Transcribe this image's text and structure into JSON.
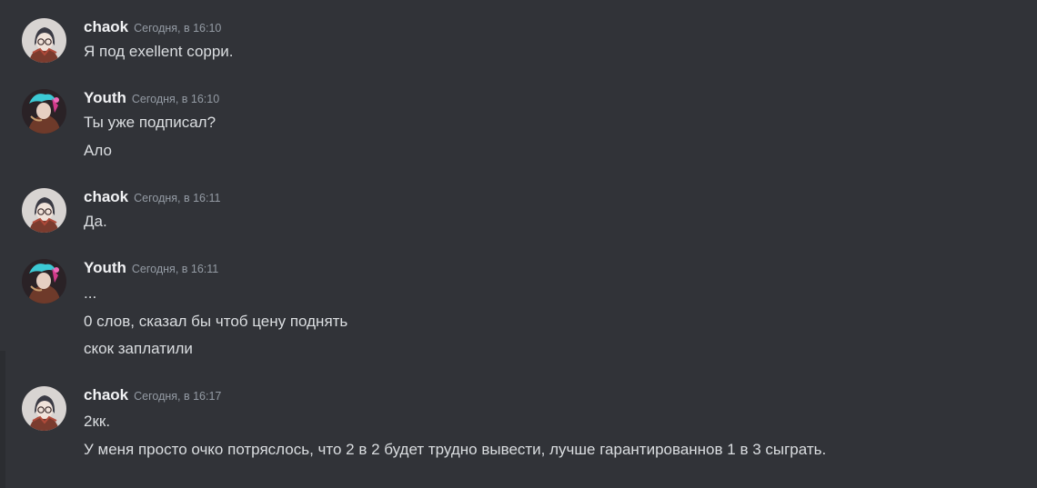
{
  "colors": {
    "background": "#313338",
    "username": "#f2f3f5",
    "timestamp": "#949ba4",
    "message_text": "#dbdee1"
  },
  "messages": [
    {
      "author": "chaok",
      "avatar_icon": "chaok-avatar-icon",
      "timestamp": "Сегодня, в 16:10",
      "lines": [
        "Я под exellent сорри."
      ]
    },
    {
      "author": "Youth",
      "avatar_icon": "youth-avatar-icon",
      "timestamp": "Сегодня, в 16:10",
      "lines": [
        "Ты уже подписал?",
        "Ало"
      ]
    },
    {
      "author": "chaok",
      "avatar_icon": "chaok-avatar-icon",
      "timestamp": "Сегодня, в 16:11",
      "lines": [
        "Да."
      ]
    },
    {
      "author": "Youth",
      "avatar_icon": "youth-avatar-icon",
      "timestamp": "Сегодня, в 16:11",
      "lines": [
        "...",
        "0 слов, сказал бы чтоб цену поднять",
        "скок заплатили"
      ]
    },
    {
      "author": "chaok",
      "avatar_icon": "chaok-avatar-icon",
      "timestamp": "Сегодня, в 16:17",
      "lines": [
        "2кк.",
        "У меня просто очко потряслось, что 2 в 2 будет трудно вывести, лучше гарантированнов 1 в 3 сыграть."
      ]
    }
  ]
}
